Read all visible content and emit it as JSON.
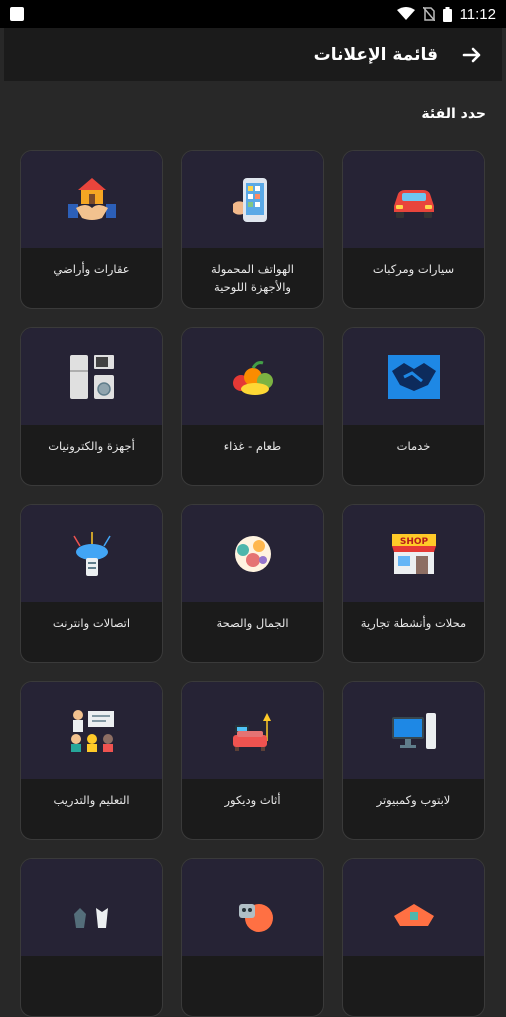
{
  "status_bar": {
    "time": "11:12"
  },
  "header": {
    "title": "قائمة الإعلانات"
  },
  "section": {
    "label": "حدد الفئة"
  },
  "categories": [
    {
      "label": "سيارات ومركبات",
      "icon": "car-icon"
    },
    {
      "label": "الهواتف المحمولة والأجهزة اللوحية",
      "icon": "smartphone-icon"
    },
    {
      "label": "عقارات وأراضي",
      "icon": "real-estate-handshake-icon"
    },
    {
      "label": "خدمات",
      "icon": "services-handshake-icon"
    },
    {
      "label": "طعام - غذاء",
      "icon": "food-icon"
    },
    {
      "label": "أجهزة والكترونيات",
      "icon": "appliances-icon"
    },
    {
      "label": "محلات وأنشطة تجارية",
      "icon": "shop-icon"
    },
    {
      "label": "الجمال والصحة",
      "icon": "beauty-health-icon"
    },
    {
      "label": "اتصالات وانترنت",
      "icon": "cloud-network-icon"
    },
    {
      "label": "لابتوب وكمبيوتر",
      "icon": "computer-icon"
    },
    {
      "label": "أثاث وديكور",
      "icon": "furniture-icon"
    },
    {
      "label": "التعليم والتدريب",
      "icon": "education-icon"
    },
    {
      "label": "",
      "icon": "partial-orange-icon"
    },
    {
      "label": "",
      "icon": "partial-robot-icon"
    },
    {
      "label": "",
      "icon": "partial-clothes-icon"
    }
  ]
}
